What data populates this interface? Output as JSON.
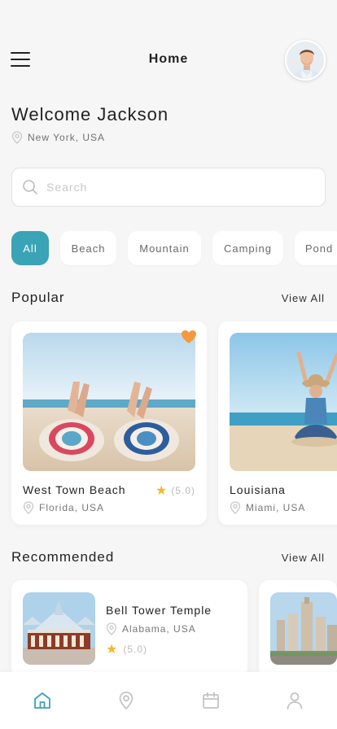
{
  "header": {
    "title": "Home",
    "menu_icon": "hamburger-menu-icon",
    "avatar_icon": "user-avatar"
  },
  "welcome": {
    "greeting": "Welcome Jackson",
    "location": "New York, USA"
  },
  "search": {
    "placeholder": "Search",
    "value": ""
  },
  "categories": {
    "items": [
      "All",
      "Beach",
      "Mountain",
      "Camping",
      "Pond"
    ],
    "selected": "All"
  },
  "popular": {
    "title": "Popular",
    "view_all": "View All",
    "cards": [
      {
        "name": "West Town Beach",
        "location": "Florida, USA",
        "rating": "(5.0)",
        "favorite": true
      },
      {
        "name": "Louisiana",
        "location": "Miami, USA"
      }
    ]
  },
  "recommended": {
    "title": "Recommended",
    "view_all": "View All",
    "cards": [
      {
        "name": "Bell Tower Temple",
        "location": "Alabama, USA",
        "rating": "(5.0)"
      }
    ]
  },
  "bottom_nav": {
    "items": [
      "home-icon",
      "map-pin-icon",
      "calendar-icon",
      "profile-icon"
    ],
    "active": "home-icon"
  },
  "colors": {
    "accent": "#3aa3b5",
    "star": "#f5b72c",
    "heart": "#f39a3d",
    "background": "#f6f6f6"
  }
}
